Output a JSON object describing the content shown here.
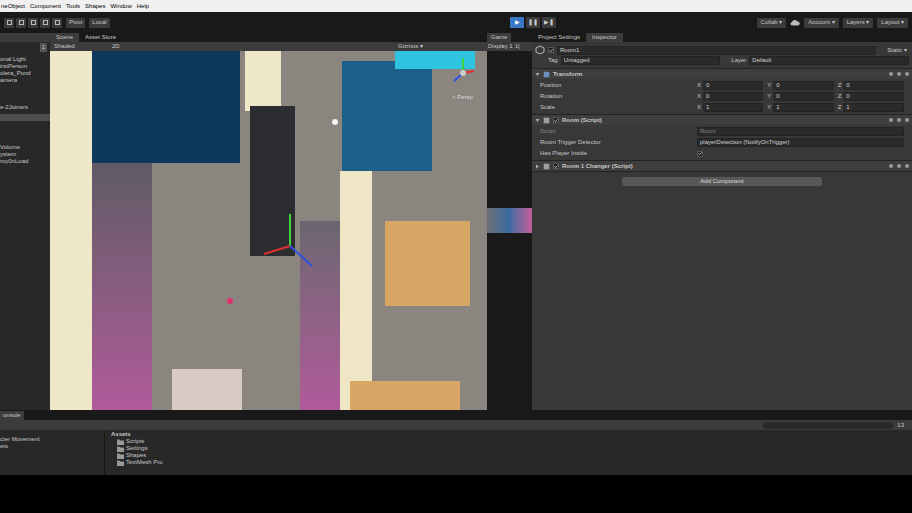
{
  "menu": [
    "neObject",
    "Component",
    "Tools",
    "Shapes",
    "Window",
    "Help"
  ],
  "toolbar": {
    "left": [
      "Pivot",
      "Local"
    ],
    "play": [
      {
        "icon": "▶",
        "selected": true
      },
      {
        "icon": "❚❚",
        "selected": false
      },
      {
        "icon": "▶❚",
        "selected": false
      }
    ],
    "right": [
      "Collab ▾",
      "Account ▾",
      "Layers ▾",
      "Layout ▾"
    ]
  },
  "hierarchy": {
    "count": "1",
    "items": [
      {
        "label": "onal Light",
        "selected": false
      },
      {
        "label": "irstPerson",
        "selected": false
      },
      {
        "label": "olera_Pond",
        "selected": false
      },
      {
        "label": "amera",
        "selected": false
      },
      {
        "label": "e-2Joiners",
        "selected": false
      },
      {
        "label": "",
        "selected": true
      },
      {
        "label": "Volume",
        "selected": false
      },
      {
        "label": "ystem",
        "selected": false
      },
      {
        "label": "roy0nLoad",
        "selected": false
      }
    ]
  },
  "scene": {
    "tabs": [
      {
        "label": "Scene",
        "selected": true
      },
      {
        "label": "Asset Store",
        "selected": false
      }
    ],
    "toolbar": [
      "Shaded",
      "2D",
      "Gizmos ▾"
    ],
    "gizmo_label": "< Persp"
  },
  "game": {
    "tabs": [
      {
        "label": "Game",
        "selected": true
      }
    ],
    "display": "Display 1",
    "scale": "1("
  },
  "inspector": {
    "tabs": [
      {
        "label": "Project Settings",
        "selected": false
      },
      {
        "label": "Inspector",
        "selected": true
      }
    ],
    "object": {
      "name": "Room1",
      "active": true,
      "static": "Static ▾",
      "tag_label": "Tag",
      "tag": "Untagged",
      "layer_label": "Layer",
      "layer": "Default"
    },
    "components": [
      {
        "title": "Transform",
        "kind": "transform",
        "has_toggle": false,
        "enabled": true,
        "expanded": true,
        "rows": [
          {
            "label": "Position",
            "x": "0",
            "y": "0",
            "z": "0"
          },
          {
            "label": "Rotation",
            "x": "0",
            "y": "0",
            "z": "0"
          },
          {
            "label": "Scale",
            "x": "1",
            "y": "1",
            "z": "1"
          }
        ]
      },
      {
        "title": "Room (Script)",
        "kind": "script",
        "has_toggle": true,
        "enabled": true,
        "expanded": true,
        "rows": [
          {
            "label": "Script",
            "kind": "object",
            "value": "Room",
            "disabled": true
          },
          {
            "label": "Room Trigger Detector",
            "kind": "object",
            "value": "playerDetection (NotifyOnTrigger)",
            "disabled": false
          },
          {
            "label": "Has Player Inside",
            "kind": "checkbox",
            "checked": true,
            "disabled": false
          }
        ]
      },
      {
        "title": "Room 1 Changer (Script)",
        "kind": "script",
        "has_toggle": true,
        "enabled": true,
        "expanded": false,
        "rows": []
      }
    ],
    "add_button": "Add Component"
  },
  "bottom": {
    "tab": "onsole",
    "left_items": [
      "cter Movement",
      "ets"
    ],
    "path": "Assets",
    "folders": [
      "Scripts",
      "Settings",
      "Shapes",
      "TextMesh Pro"
    ],
    "count": "13"
  }
}
